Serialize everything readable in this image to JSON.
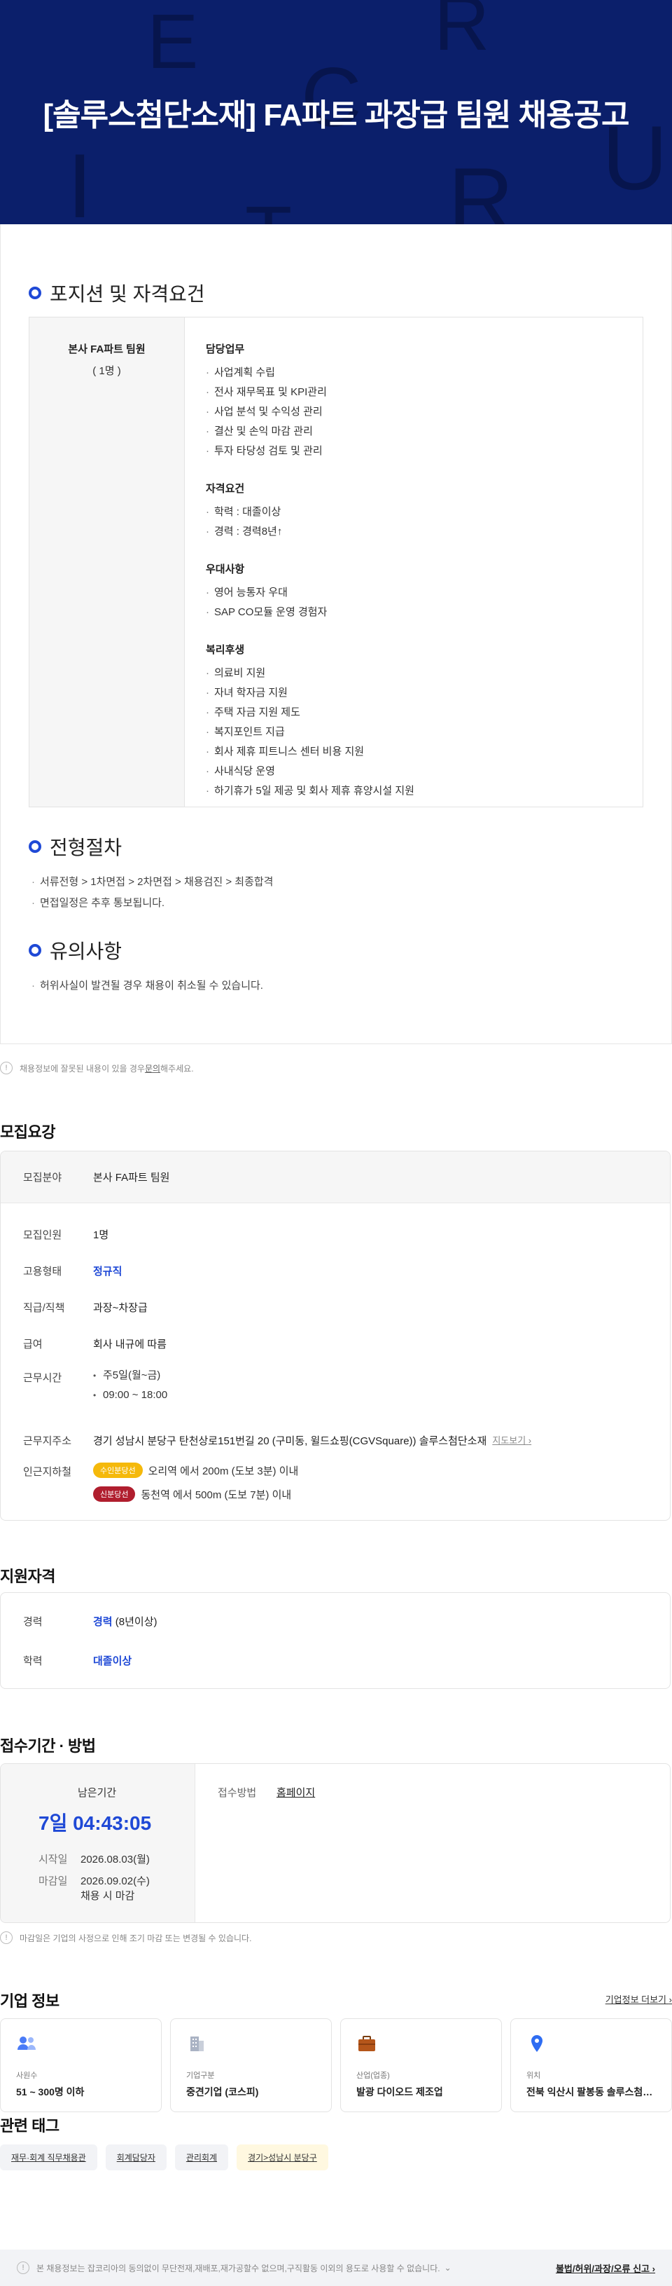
{
  "hero": {
    "title": "[솔루스첨단소재] FA파트 과장급 팀원 채용공고",
    "bg_letters": [
      "E",
      "R",
      "C",
      "U",
      "I",
      "R",
      "T"
    ],
    "bg_color": "#0b1f6b"
  },
  "detail": {
    "position_heading": "포지션 및 자격요건",
    "role": "본사 FA파트 팀원",
    "headcount": "( 1명 )",
    "groups": [
      {
        "title": "담당업무",
        "items": [
          "사업계획 수립",
          "전사 재무목표 및 KPI관리",
          "사업 분석 및 수익성 관리",
          "결산 및 손익 마감 관리",
          "투자 타당성 검토 및 관리"
        ]
      },
      {
        "title": "자격요건",
        "items": [
          "학력 : 대졸이상",
          "경력 : 경력8년↑"
        ]
      },
      {
        "title": "우대사항",
        "items": [
          "영어 능통자 우대",
          "SAP CO모듈 운영 경험자"
        ]
      },
      {
        "title": "복리후생",
        "items": [
          "의료비 지원",
          "자녀 학자금 지원",
          "주택 자금 지원 제도",
          "복지포인트 지급",
          "회사 제휴 피트니스 센터 비용 지원",
          "사내식당 운영",
          "하기휴가 5일 제공 및 회사 제휴 휴양시설 지원"
        ]
      }
    ],
    "process_heading": "전형절차",
    "process_items": [
      "서류전형 > 1차면접 > 2차면접 > 채용검진 > 최종합격",
      "면접일정은 추후 통보됩니다."
    ],
    "caution_heading": "유의사항",
    "caution_items": [
      "허위사실이 발견될 경우 채용이 취소될 수 있습니다."
    ]
  },
  "notice1": {
    "text": "채용정보에 잘못된 내용이 있을 경우 ",
    "link": "문의",
    "suffix": "해주세요."
  },
  "recruit": {
    "heading": "모집요강",
    "field_label": "모집분야",
    "field_value": "본사 FA파트 팀원",
    "count_label": "모집인원",
    "count_value": "1명",
    "type_label": "고용형태",
    "type_value": "정규직",
    "rank_label": "직급/직책",
    "rank_value": "과장~차장급",
    "salary_label": "급여",
    "salary_value": "회사 내규에 따름",
    "hours_label": "근무시간",
    "hours": [
      "주5일(월~금)",
      "09:00 ~ 18:00"
    ],
    "addr_label": "근무지주소",
    "addr_value": "경기 성남시 분당구 탄천상로151번길 20 (구미동, 윌드쇼핑(CGVSquare)) 솔루스첨단소재",
    "map_link": "지도보기",
    "subway_label": "인근지하철",
    "subways": [
      {
        "line": "수인분당선",
        "text": "오리역 에서 200m (도보 3분) 이내",
        "color": "#f5b90b"
      },
      {
        "line": "신분당선",
        "text": "동천역 에서 500m (도보 7분) 이내",
        "color": "#b01e2e"
      }
    ]
  },
  "qual": {
    "heading": "지원자격",
    "career_label": "경력",
    "career_value": "경력",
    "career_note": " (8년이상)",
    "edu_label": "학력",
    "edu_value": "대졸이상"
  },
  "period": {
    "heading": "접수기간 · 방법",
    "remain_label": "남은기간",
    "remain_value": "7일 04:43:05",
    "start_label": "시작일",
    "start_value": "2026.08.03(월)",
    "end_label": "마감일",
    "end_value": "2026.09.02(수)",
    "end_note": "채용 시 마감",
    "method_label": "접수방법",
    "method_value": "홈페이지"
  },
  "notice2": {
    "text": "마감일은 기업의 사정으로 인해 조기 마감 또는 변경될 수 있습니다."
  },
  "company": {
    "heading": "기업 정보",
    "more": "기업정보 더보기",
    "cards": [
      {
        "icon": "people-icon",
        "label": "사원수",
        "value": "51 ~ 300명 이하"
      },
      {
        "icon": "building-icon",
        "label": "기업구분",
        "value": "중견기업 (코스피)"
      },
      {
        "icon": "briefcase-icon",
        "label": "산업(업종)",
        "value": "발광 다이오드 제조업"
      },
      {
        "icon": "location-pin-icon",
        "label": "위치",
        "value": "전북 익산시 팔봉동 솔루스첨단소재"
      }
    ]
  },
  "tags": {
    "heading": "관련 태그",
    "items": [
      "재무·회계 직무채용관",
      "회계담당자",
      "관리회계",
      "경기>성남시 분당구"
    ]
  },
  "footer": {
    "text": "본 채용정보는 잡코리아의 동의없이 무단전재,재배포,재가공할수 없으며,구직활동 이외의 용도로 사용할 수 없습니다.",
    "report": "불법/허위/과장/오류 신고"
  }
}
